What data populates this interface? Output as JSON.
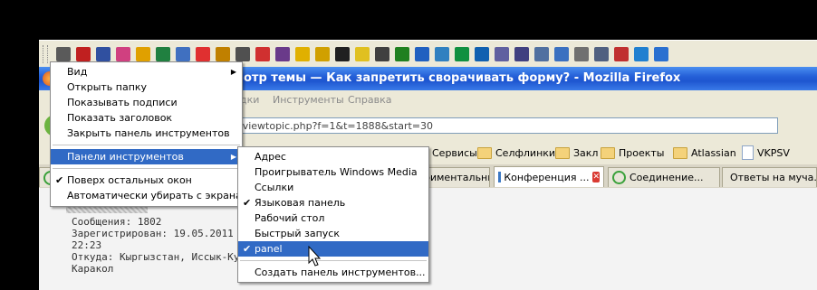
{
  "toolbar_icons": [
    "tool-icon",
    "chain-icon",
    "doc-icon",
    "puzzle-icon",
    "app-icon",
    "game-icon",
    "cube-icon",
    "star-icon",
    "figure-icon",
    "mask-icon",
    "a-icon",
    "key-icon",
    "speaker-icon",
    "speaker-icon",
    "film-icon",
    "star-icon",
    "doc-icon",
    "pencil-icon",
    "ie-icon",
    "globe-icon",
    "grid-icon",
    "triangle-icon",
    "info-icon",
    "doc-icon",
    "doc-icon",
    "shield-icon",
    "doc-icon",
    "doc-icon",
    "bug-icon",
    "blue-icon",
    "edge-icon"
  ],
  "window": {
    "title": "отр темы — Как запретить сворачивать форму? - Mozilla Firefox",
    "menus": [
      "дки",
      "Инструменты",
      "Справка"
    ],
    "url": "/viewtopic.php?f=1&t=1888&start=30"
  },
  "bookmarks": [
    {
      "label": "Сервисы",
      "icon": "folder-icon"
    },
    {
      "label": "Селфлинки",
      "icon": "folder-icon"
    },
    {
      "label": "Закл",
      "icon": "folder-icon"
    },
    {
      "label": "Проекты",
      "icon": "folder-icon"
    },
    {
      "label": "Atlassian",
      "icon": "folder-icon"
    },
    {
      "label": "VKPSV",
      "icon": "doc-icon"
    }
  ],
  "tabs": [
    {
      "label": "риментальные..."
    },
    {
      "label": "Конференция ...",
      "active": true
    },
    {
      "label": "Соединение..."
    },
    {
      "label": "Ответы на муча..."
    }
  ],
  "post": {
    "messages": "Сообщения: 1802",
    "registered": "Зарегистрирован: 19.05.2011 (",
    "time": "22:23",
    "location": "Откуда: Кыргызстан, Иссык-Кул",
    "location2": "Каракол"
  },
  "context_menu": {
    "items": [
      {
        "label": "Вид",
        "submenu": true
      },
      {
        "label": "Открыть папку"
      },
      {
        "label": "Показывать подписи"
      },
      {
        "label": "Показать заголовок"
      },
      {
        "label": "Закрыть панель инструментов"
      },
      {
        "label": "Панели инструментов",
        "submenu": true,
        "selected": true
      },
      {
        "label": "Поверх остальных окон",
        "checked": true
      },
      {
        "label": "Автоматически убирать с экрана"
      }
    ]
  },
  "submenu": {
    "items": [
      {
        "label": "Адрес"
      },
      {
        "label": "Проигрыватель Windows Media"
      },
      {
        "label": "Ссылки"
      },
      {
        "label": "Языковая панель",
        "checked": true
      },
      {
        "label": "Рабочий стол"
      },
      {
        "label": "Быстрый запуск"
      },
      {
        "label": "panel",
        "checked": true,
        "selected": true
      },
      {
        "label": "Создать панель инструментов..."
      }
    ]
  },
  "colors": {
    "selection": "#316ac5",
    "titlebar": "#2560d8"
  }
}
